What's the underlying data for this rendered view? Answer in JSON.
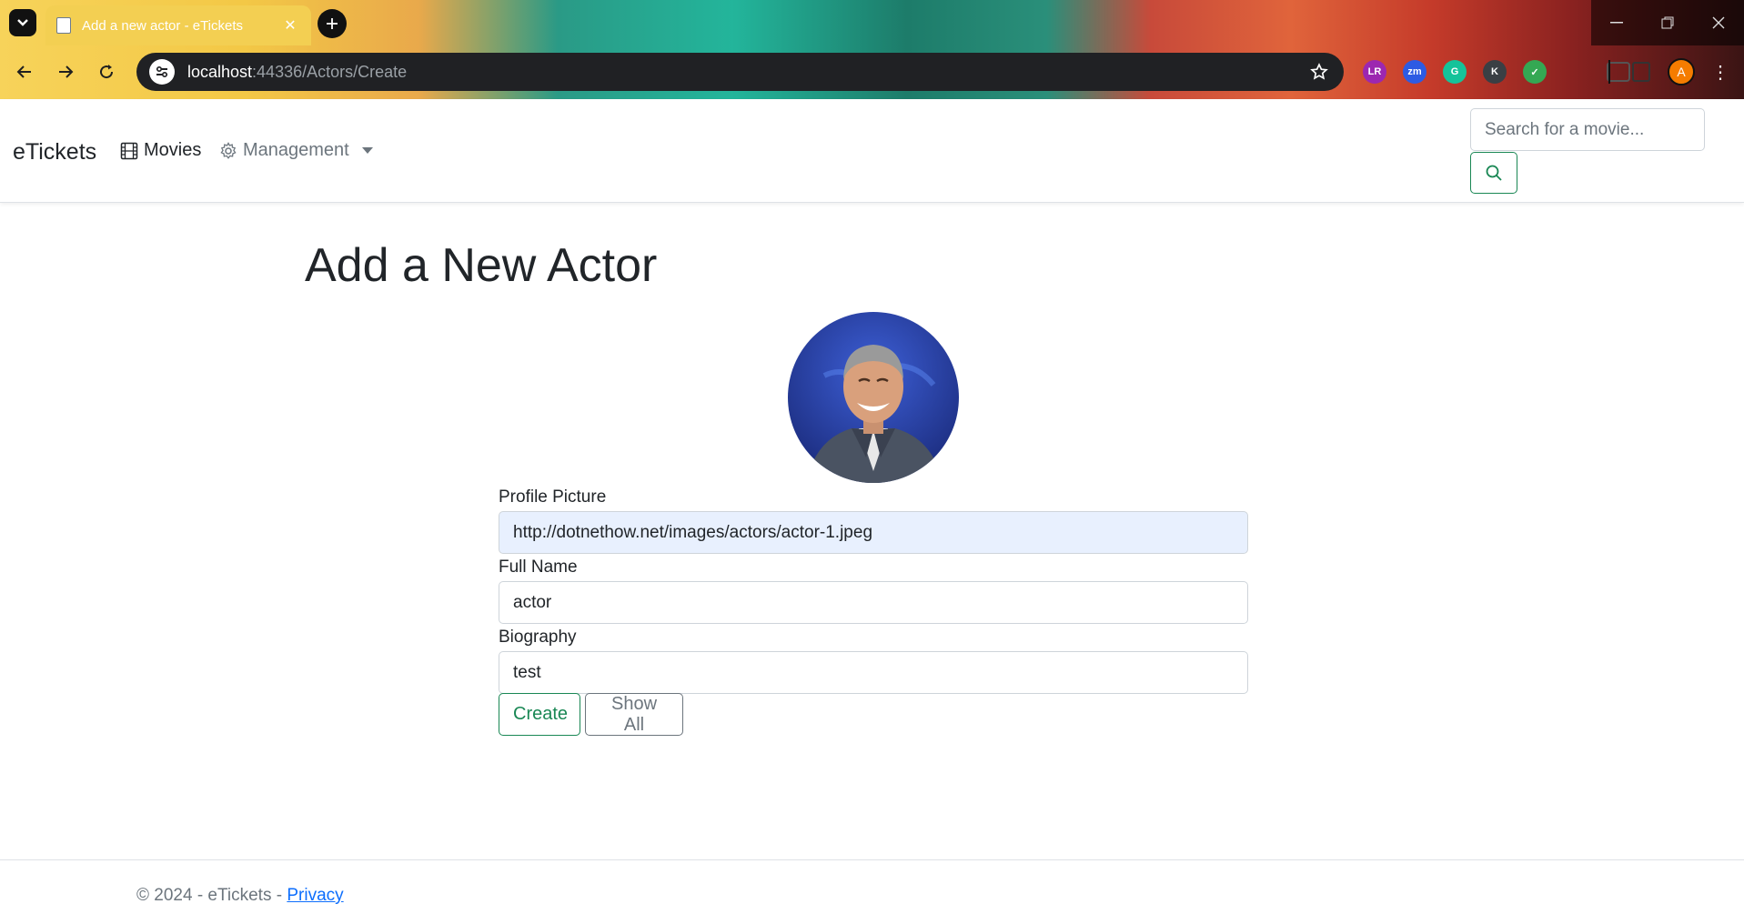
{
  "browser": {
    "tab_title": "Add a new actor - eTickets",
    "url_host": "localhost",
    "url_path": ":44336/Actors/Create",
    "profile_initial": "A",
    "extensions": [
      {
        "name": "lr-extension-icon",
        "label": "LR",
        "color": "#9c27b0"
      },
      {
        "name": "zoom-extension-icon",
        "label": "zm",
        "color": "#2d5be3"
      },
      {
        "name": "grammarly-extension-icon",
        "label": "G",
        "color": "#15c39a"
      },
      {
        "name": "k-extension-icon",
        "label": "K",
        "color": "#3a3f44"
      },
      {
        "name": "shield-extension-icon",
        "label": "✓",
        "color": "#34a853"
      }
    ]
  },
  "navbar": {
    "brand": "eTickets",
    "movies_label": "Movies",
    "management_label": "Management",
    "search_placeholder": "Search for a movie..."
  },
  "form": {
    "title": "Add a New Actor",
    "profile_picture_label": "Profile Picture",
    "profile_picture_value": "http://dotnethow.net/images/actors/actor-1.jpeg",
    "full_name_label": "Full Name",
    "full_name_value": "actor",
    "biography_label": "Biography",
    "biography_value": "test",
    "create_label": "Create",
    "show_all_label": "Show All"
  },
  "footer": {
    "copyright": "© 2024 - eTickets - ",
    "privacy_label": "Privacy"
  },
  "colors": {
    "success": "#198754",
    "secondary": "#6c757d",
    "link": "#0d6efd",
    "autofill": "#e8f0fe"
  }
}
